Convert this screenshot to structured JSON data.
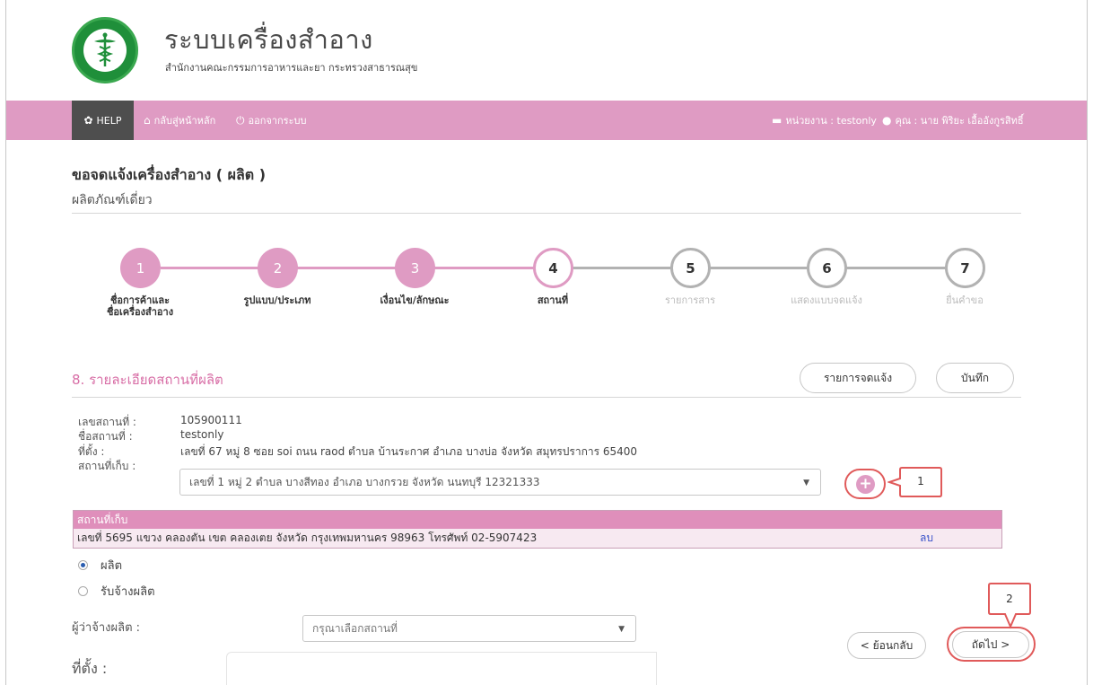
{
  "header": {
    "title": "ระบบเครื่องสำอาง",
    "subtitle": "สำนักงานคณะกรรมการอาหารและยา กระทรวงสาธารณสุข"
  },
  "navbar": {
    "help": "HELP",
    "home": "กลับสู่หน้าหลัก",
    "logout": "ออกจากระบบ",
    "unit": "หน่วยงาน : testonly",
    "user": "คุณ : นาย พิริยะ เอื้ออังกูรสิทธิ์",
    "colors": {
      "bar": "#df9bc3",
      "help": "#4e4e4e"
    }
  },
  "page": {
    "title": "ขอจดแจ้งเครื่องสำอาง ( ผลิต )",
    "subtitle": "ผลิตภัณฑ์เดี่ยว"
  },
  "stepper": {
    "steps": [
      {
        "num": "1",
        "label_line1": "ชื่อการค้าและ",
        "label_line2": "ชื่อเครื่องสำอาง",
        "state": "done"
      },
      {
        "num": "2",
        "label_line1": "รูปแบบ/ประเภท",
        "label_line2": "",
        "state": "done"
      },
      {
        "num": "3",
        "label_line1": "เงื่อนไข/ลักษณะ",
        "label_line2": "",
        "state": "done"
      },
      {
        "num": "4",
        "label_line1": "สถานที่",
        "label_line2": "",
        "state": "current"
      },
      {
        "num": "5",
        "label_line1": "รายการสาร",
        "label_line2": "",
        "state": "todo"
      },
      {
        "num": "6",
        "label_line1": "แสดงแบบจดแจ้ง",
        "label_line2": "",
        "state": "todo"
      },
      {
        "num": "7",
        "label_line1": "ยื่นคำขอ",
        "label_line2": "",
        "state": "todo"
      }
    ]
  },
  "section": {
    "title": "8. รายละเอียดสถานที่ผลิต",
    "record_button": "รายการจดแจ้ง",
    "save_button": "บันทึก"
  },
  "info": {
    "place_no_label": "เลขสถานที่ :",
    "place_no": "105900111",
    "place_name_label": "ชื่อสถานที่ :",
    "place_name": "testonly",
    "address_label": "ที่ตั้ง :",
    "address": "เลขที่ 67 หมู่ 8 ซอย soi ถนน raod ตำบล บ้านระกาศ อำเภอ บางบ่อ จังหวัด สมุทรปราการ 65400",
    "storage_label": "สถานที่เก็บ :",
    "storage_selected": "เลขที่ 1 หมู่ 2 ตำบล บางสีทอง อำเภอ บางกรวย จังหวัด นนทบุรี 12321333"
  },
  "callouts": {
    "first": "1",
    "second": "2"
  },
  "store_table": {
    "header": "สถานที่เก็บ",
    "rows": [
      {
        "address": "เลขที่ 5695 แขวง คลองตัน เขต คลองเตย จังหวัด กรุงเทพมหานคร 98963 โทรศัพท์ 02-5907423",
        "action": "ลบ"
      }
    ]
  },
  "radios": {
    "produce": "ผลิต",
    "contract": "รับจ้างผลิต",
    "selected": "produce"
  },
  "form": {
    "employer_label": "ผู้ว่าจ้างผลิต :",
    "employer_placeholder": "กรุณาเลือกสถานที่",
    "location_label": "ที่ตั้ง :"
  },
  "footer_nav": {
    "back": "< ย้อนกลับ",
    "next": "ถัดไป >"
  }
}
